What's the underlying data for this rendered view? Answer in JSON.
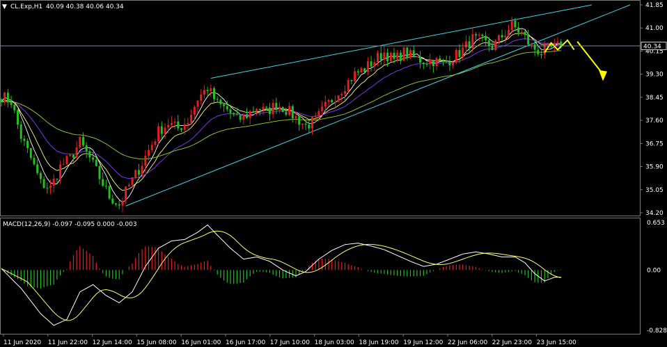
{
  "header": {
    "symbol": "CL.Exp,H1",
    "ohlc": "40.09 40.38 40.06 40.34"
  },
  "macd_label": "MACD(12,26,9) -0.097 -0.095 0.000 -0.003",
  "current_price": "40.34",
  "colors": {
    "background": "#000000",
    "bull": "#e02020",
    "bear": "#22c022",
    "ma_fast": "#ffffff",
    "ma_mid": "#ffff66",
    "ma_slow_violet": "#8a3cff",
    "ma_slow_green": "#9ad430",
    "trendline": "#3fd6e8",
    "arrow": "#ffff00",
    "macd_line": "#ffffff",
    "signal_line": "#ffff66",
    "hist_pos": "#e02020",
    "hist_neg": "#22c022"
  },
  "chart_data": [
    {
      "type": "candlestick",
      "title": "CL.Exp,H1",
      "ylim": [
        34.2,
        41.85
      ],
      "y_ticks": [
        "41.85",
        "41.00",
        "40.15",
        "39.30",
        "38.45",
        "37.60",
        "36.75",
        "35.90",
        "35.05",
        "34.20"
      ],
      "x_ticks": [
        "11 Jun 2020",
        "11 Jun 22:00",
        "12 Jun 14:00",
        "15 Jun 08:00",
        "16 Jun 01:00",
        "16 Jun 17:00",
        "17 Jun 10:00",
        "18 Jun 03:00",
        "18 Jun 19:00",
        "19 Jun 12:00",
        "22 Jun 06:00",
        "22 Jun 23:00",
        "23 Jun 15:00"
      ],
      "close_anchors": [
        [
          0,
          38.5
        ],
        [
          3,
          38.3
        ],
        [
          6,
          37.0
        ],
        [
          9,
          36.2
        ],
        [
          12,
          35.3
        ],
        [
          15,
          35.1
        ],
        [
          18,
          35.9
        ],
        [
          21,
          36.2
        ],
        [
          24,
          36.8
        ],
        [
          27,
          36.2
        ],
        [
          30,
          35.5
        ],
        [
          33,
          34.8
        ],
        [
          36,
          34.5
        ],
        [
          39,
          35.2
        ],
        [
          42,
          35.8
        ],
        [
          45,
          36.5
        ],
        [
          48,
          37.2
        ],
        [
          51,
          37.5
        ],
        [
          54,
          37.3
        ],
        [
          57,
          37.6
        ],
        [
          60,
          38.4
        ],
        [
          63,
          38.8
        ],
        [
          66,
          38.2
        ],
        [
          69,
          38.0
        ],
        [
          72,
          37.6
        ],
        [
          75,
          37.8
        ],
        [
          78,
          38.1
        ],
        [
          81,
          37.9
        ],
        [
          84,
          38.2
        ],
        [
          87,
          38.0
        ],
        [
          90,
          37.7
        ],
        [
          93,
          37.4
        ],
        [
          96,
          37.6
        ],
        [
          99,
          38.1
        ],
        [
          102,
          38.5
        ],
        [
          105,
          38.9
        ],
        [
          108,
          39.3
        ],
        [
          111,
          39.5
        ],
        [
          114,
          39.8
        ],
        [
          117,
          40.1
        ],
        [
          120,
          39.8
        ],
        [
          123,
          40.1
        ],
        [
          126,
          39.9
        ],
        [
          129,
          39.8
        ],
        [
          132,
          39.8
        ],
        [
          135,
          39.7
        ],
        [
          138,
          39.9
        ],
        [
          141,
          40.2
        ],
        [
          144,
          40.6
        ],
        [
          147,
          40.5
        ],
        [
          150,
          40.3
        ],
        [
          153,
          40.7
        ],
        [
          156,
          41.1
        ],
        [
          159,
          40.8
        ],
        [
          162,
          40.3
        ],
        [
          165,
          40.1
        ],
        [
          168,
          40.25
        ],
        [
          171,
          40.34
        ]
      ],
      "macd": {
        "label": "MACD(12,26,9)",
        "ylim": [
          -0.828,
          0.653
        ],
        "y_ticks": [
          "0.653",
          "0.00",
          "-0.828"
        ],
        "macd_anchors": [
          [
            0,
            0.02
          ],
          [
            6,
            -0.25
          ],
          [
            12,
            -0.6
          ],
          [
            16,
            -0.76
          ],
          [
            20,
            -0.68
          ],
          [
            24,
            -0.3
          ],
          [
            28,
            -0.2
          ],
          [
            32,
            -0.35
          ],
          [
            36,
            -0.45
          ],
          [
            40,
            -0.3
          ],
          [
            44,
            0.05
          ],
          [
            48,
            0.3
          ],
          [
            52,
            0.4
          ],
          [
            56,
            0.42
          ],
          [
            60,
            0.52
          ],
          [
            63,
            0.62
          ],
          [
            66,
            0.48
          ],
          [
            70,
            0.3
          ],
          [
            74,
            0.15
          ],
          [
            78,
            0.18
          ],
          [
            82,
            0.12
          ],
          [
            86,
            0.0
          ],
          [
            90,
            -0.08
          ],
          [
            93,
            -0.02
          ],
          [
            97,
            0.15
          ],
          [
            101,
            0.27
          ],
          [
            105,
            0.35
          ],
          [
            109,
            0.37
          ],
          [
            113,
            0.33
          ],
          [
            117,
            0.28
          ],
          [
            121,
            0.2
          ],
          [
            125,
            0.12
          ],
          [
            129,
            0.05
          ],
          [
            133,
            0.08
          ],
          [
            137,
            0.15
          ],
          [
            141,
            0.22
          ],
          [
            145,
            0.25
          ],
          [
            149,
            0.22
          ],
          [
            153,
            0.18
          ],
          [
            157,
            0.18
          ],
          [
            160,
            0.1
          ],
          [
            163,
            -0.05
          ],
          [
            166,
            -0.15
          ],
          [
            169,
            -0.1
          ],
          [
            171,
            -0.097
          ]
        ]
      }
    }
  ]
}
